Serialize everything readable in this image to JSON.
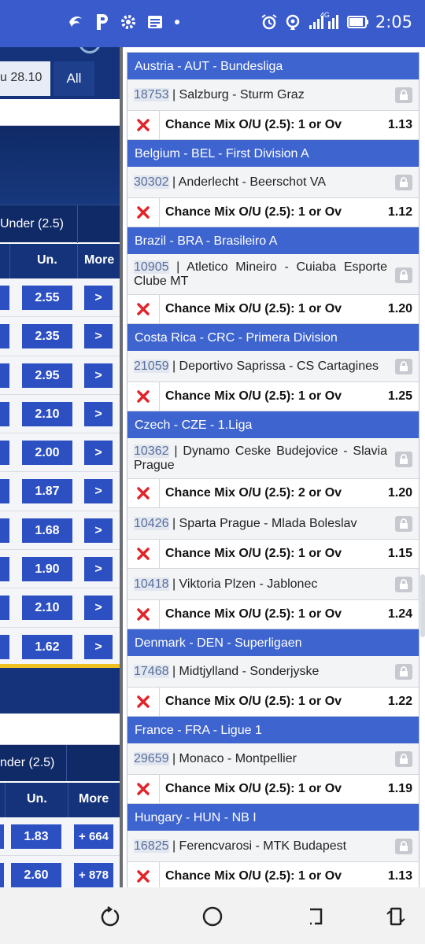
{
  "status_bar": {
    "time": "2:05",
    "network": "4G",
    "icons": [
      "flag-icon",
      "p-icon",
      "gear-icon",
      "news-icon",
      "dot-icon",
      "alarm-icon",
      "hotspot-icon",
      "signal-icon",
      "battery-icon"
    ]
  },
  "left_panel": {
    "date_label": "u 28.10",
    "all_label": "All",
    "group1": {
      "header_label": "Under (2.5)",
      "col_under": "Un.",
      "col_more": "More",
      "rows": [
        {
          "under": "2.55",
          "more": ">"
        },
        {
          "under": "2.35",
          "more": ">"
        },
        {
          "under": "2.95",
          "more": ">"
        },
        {
          "under": "2.10",
          "more": ">"
        },
        {
          "under": "2.00",
          "more": ">"
        },
        {
          "under": "1.87",
          "more": ">"
        },
        {
          "under": "1.68",
          "more": ">"
        },
        {
          "under": "1.90",
          "more": ">"
        },
        {
          "under": "2.10",
          "more": ">"
        },
        {
          "under": "1.62",
          "more": ">"
        }
      ]
    },
    "group2": {
      "header_label": "nder (2.5)",
      "col_under": "Un.",
      "col_more": "More",
      "rows": [
        {
          "under": "1.83",
          "more": "+ 664"
        },
        {
          "under": "2.60",
          "more": "+ 878"
        }
      ]
    }
  },
  "right_panel": {
    "leagues": [
      {
        "name": "Austria - AUT - Bundesliga",
        "matches": [
          {
            "code": "18753",
            "teams": "Salzburg - Sturm Graz",
            "bet": "Chance Mix O/U (2.5): 1 or Ov",
            "odd": "1.13",
            "tall": false
          }
        ]
      },
      {
        "name": "Belgium - BEL - First Division A",
        "matches": [
          {
            "code": "30302",
            "teams": "Anderlecht - Beerschot VA",
            "bet": "Chance Mix O/U (2.5): 1 or Ov",
            "odd": "1.12",
            "tall": false
          }
        ]
      },
      {
        "name": "Brazil - BRA - Brasileiro A",
        "matches": [
          {
            "code": "10905",
            "teams": "Atletico Mineiro - Cuiaba Esporte Clube MT",
            "bet": "Chance Mix O/U (2.5): 1 or Ov",
            "odd": "1.20",
            "tall": true
          }
        ]
      },
      {
        "name": "Costa Rica - CRC - Primera Division",
        "matches": [
          {
            "code": "21059",
            "teams": "Deportivo Saprissa - CS Cartagines",
            "bet": "Chance Mix O/U (2.5): 1 or Ov",
            "odd": "1.25",
            "tall": false
          }
        ]
      },
      {
        "name": "Czech - CZE - 1.Liga",
        "matches": [
          {
            "code": "10362",
            "teams": "Dynamo Ceske Budejovice - Slavia Prague",
            "bet": "Chance Mix O/U (2.5): 2 or Ov",
            "odd": "1.20",
            "tall": true
          },
          {
            "code": "10426",
            "teams": "Sparta Prague - Mlada Boleslav",
            "bet": "Chance Mix O/U (2.5): 1 or Ov",
            "odd": "1.15",
            "tall": false
          },
          {
            "code": "10418",
            "teams": "Viktoria Plzen - Jablonec",
            "bet": "Chance Mix O/U (2.5): 1 or Ov",
            "odd": "1.24",
            "tall": false
          }
        ]
      },
      {
        "name": "Denmark - DEN - Superligaen",
        "matches": [
          {
            "code": "17468",
            "teams": "Midtjylland - Sonderjyske",
            "bet": "Chance Mix O/U (2.5): 1 or Ov",
            "odd": "1.22",
            "tall": false
          }
        ]
      },
      {
        "name": "France - FRA - Ligue 1",
        "matches": [
          {
            "code": "29659",
            "teams": "Monaco - Montpellier",
            "bet": "Chance Mix O/U (2.5): 1 or Ov",
            "odd": "1.19",
            "tall": false
          }
        ]
      },
      {
        "name": "Hungary - HUN - NB I",
        "matches": [
          {
            "code": "16825",
            "teams": "Ferencvarosi - MTK Budapest",
            "bet": "Chance Mix O/U (2.5): 1 or Ov",
            "odd": "1.13",
            "tall": false
          }
        ]
      }
    ]
  },
  "colors": {
    "status_bar": "#3a5bcc",
    "league_header": "#3e64cf",
    "odds_button": "#2c4fc2",
    "dark_navy": "#14337a",
    "remove_x": "#e0252b"
  }
}
